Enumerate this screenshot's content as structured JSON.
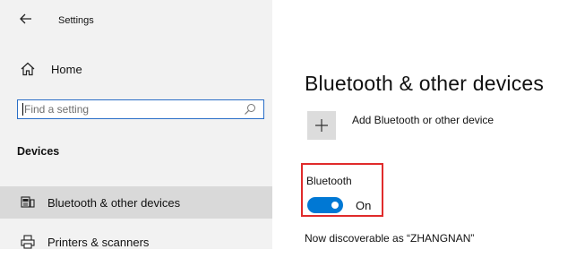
{
  "window": {
    "title": "Settings"
  },
  "sidebar": {
    "home_label": "Home",
    "search": {
      "placeholder": "Find a setting"
    },
    "section_heading": "Devices",
    "items": [
      {
        "label": "Bluetooth & other devices",
        "icon": "bluetooth-devices-icon",
        "selected": true
      },
      {
        "label": "Printers & scanners",
        "icon": "printer-icon",
        "selected": false
      }
    ]
  },
  "main": {
    "title": "Bluetooth & other devices",
    "add_device_label": "Add Bluetooth or other device",
    "bluetooth": {
      "label": "Bluetooth",
      "toggle_state": "On",
      "enabled": true
    },
    "discoverable_text": "Now discoverable as “ZHANGNAN”"
  },
  "colors": {
    "accent": "#0078d4",
    "highlight_border": "#e02b2b",
    "sidebar_bg": "#f2f2f2",
    "selected_bg": "#d9d9d9"
  }
}
